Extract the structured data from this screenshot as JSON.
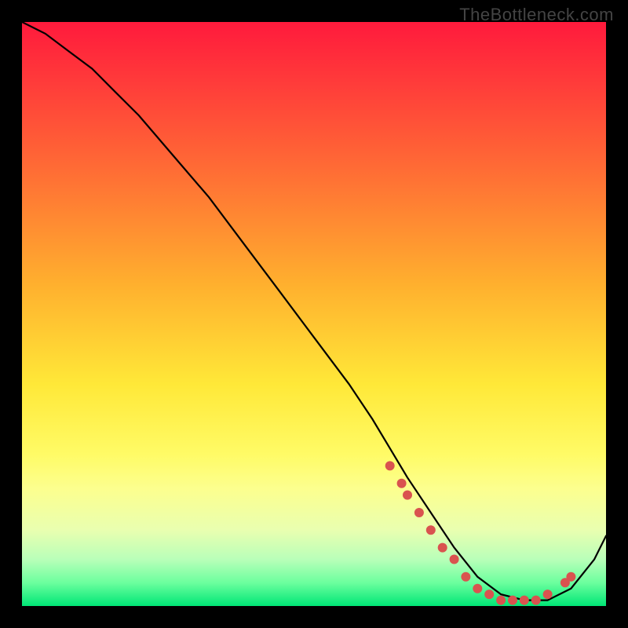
{
  "watermark": "TheBottleneck.com",
  "chart_data": {
    "type": "line",
    "title": "",
    "xlabel": "",
    "ylabel": "",
    "xlim": [
      0,
      100
    ],
    "ylim": [
      0,
      100
    ],
    "series": [
      {
        "name": "curve",
        "x": [
          0,
          4,
          8,
          12,
          16,
          20,
          26,
          32,
          38,
          44,
          50,
          56,
          60,
          63,
          66,
          70,
          74,
          78,
          82,
          86,
          90,
          94,
          98,
          100
        ],
        "y": [
          100,
          98,
          95,
          92,
          88,
          84,
          77,
          70,
          62,
          54,
          46,
          38,
          32,
          27,
          22,
          16,
          10,
          5,
          2,
          1,
          1,
          3,
          8,
          12
        ]
      }
    ],
    "markers": {
      "name": "highlight-band",
      "color": "#d9534f",
      "x": [
        63,
        65,
        66,
        68,
        70,
        72,
        74,
        76,
        78,
        80,
        82,
        84,
        86,
        88,
        90,
        93,
        94
      ],
      "y": [
        24,
        21,
        19,
        16,
        13,
        10,
        8,
        5,
        3,
        2,
        1,
        1,
        1,
        1,
        2,
        4,
        5
      ]
    }
  }
}
